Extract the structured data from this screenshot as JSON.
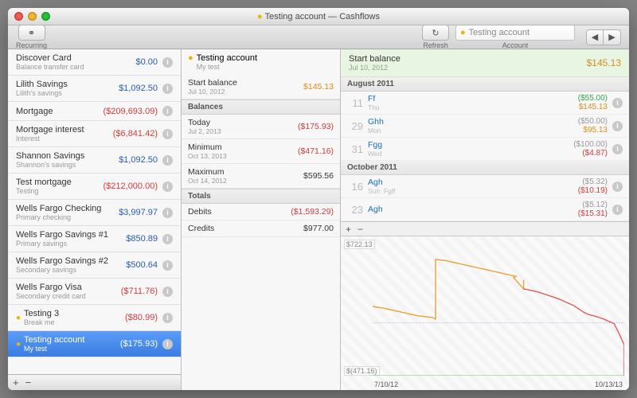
{
  "window": {
    "title": "Testing account — Cashflows"
  },
  "toolbar": {
    "recurring": "Recurring",
    "refresh": "Refresh",
    "account_label": "Account",
    "account_field": "Testing account"
  },
  "accounts": [
    {
      "name": "Discover Card",
      "sub": "Balance transfer card",
      "amount": "$0.00",
      "cls": "blue"
    },
    {
      "name": "Lilith Savings",
      "sub": "Lilith's savings",
      "amount": "$1,092.50",
      "cls": "blue"
    },
    {
      "name": "Mortgage",
      "sub": "",
      "amount": "($209,693.09)",
      "cls": "red"
    },
    {
      "name": "Mortgage interest",
      "sub": "Interest",
      "amount": "($6,841.42)",
      "cls": "red"
    },
    {
      "name": "Shannon Savings",
      "sub": "Shannon's savings",
      "amount": "$1,092.50",
      "cls": "blue"
    },
    {
      "name": "Test mortgage",
      "sub": "Testing",
      "amount": "($212,000.00)",
      "cls": "red"
    },
    {
      "name": "Wells Fargo Checking",
      "sub": "Primary checking",
      "amount": "$3,997.97",
      "cls": "blue"
    },
    {
      "name": "Wells Fargo Savings #1",
      "sub": "Primary savings",
      "amount": "$850.89",
      "cls": "blue"
    },
    {
      "name": "Wells Fargo Savings #2",
      "sub": "Secondary savings",
      "amount": "$500.64",
      "cls": "blue"
    },
    {
      "name": "Wells Fargo Visa",
      "sub": "Secondary credit card",
      "amount": "($711.76)",
      "cls": "red"
    },
    {
      "name": "Testing 3",
      "sub": "Break me",
      "amount": "($80.99)",
      "cls": "red",
      "coin": true
    },
    {
      "name": "Testing account",
      "sub": "My test",
      "amount": "($175.93)",
      "cls": "red",
      "coin": true,
      "selected": true
    }
  ],
  "summary": {
    "title": "Testing account",
    "subtitle": "My test",
    "start": {
      "label": "Start balance",
      "date": "Jul 10, 2012",
      "value": "$145.13",
      "cls": "orange"
    },
    "balances_hdr": "Balances",
    "today": {
      "label": "Today",
      "date": "Jul 2, 2013",
      "value": "($175.93)",
      "cls": "red"
    },
    "minimum": {
      "label": "Minimum",
      "date": "Oct 13, 2013",
      "value": "($471.16)",
      "cls": "red"
    },
    "maximum": {
      "label": "Maximum",
      "date": "Oct 14, 2012",
      "value": "$595.56",
      "cls": "black"
    },
    "totals_hdr": "Totals",
    "debits": {
      "label": "Debits",
      "value": "($1,593.29)",
      "cls": "red"
    },
    "credits": {
      "label": "Credits",
      "value": "$977.00",
      "cls": "black"
    }
  },
  "ledger": {
    "start": {
      "label": "Start balance",
      "date": "Jul 10, 2012",
      "value": "$145.13"
    },
    "months": [
      {
        "label": "August 2011",
        "tx": [
          {
            "day": "11",
            "wd": "Thu",
            "name": "Ff",
            "delta": "($55.00)",
            "bal": "$145.13",
            "dcls": "green",
            "bcls": "orange"
          },
          {
            "day": "29",
            "wd": "Mon",
            "name": "Ghh",
            "delta": "($50.00)",
            "bal": "$95.13",
            "dcls": "gray",
            "bcls": "orange"
          },
          {
            "day": "31",
            "wd": "Wed",
            "name": "Fgg",
            "delta": "($100.00)",
            "bal": "($4.87)",
            "dcls": "gray",
            "bcls": "red"
          }
        ]
      },
      {
        "label": "October 2011",
        "tx": [
          {
            "day": "16",
            "wd": "Sun",
            "sub": "Fgff",
            "name": "Agh",
            "delta": "($5.32)",
            "bal": "($10.19)",
            "dcls": "gray",
            "bcls": "red"
          },
          {
            "day": "23",
            "wd": "",
            "name": "Agh",
            "delta": "($5.12)",
            "bal": "($15.31)",
            "dcls": "gray",
            "bcls": "red"
          }
        ]
      }
    ]
  },
  "chart_data": {
    "type": "line",
    "xlabel_left": "7/10/12",
    "xlabel_right": "10/13/13",
    "ylim": [
      -471.16,
      722.13
    ],
    "ylabel_top": "$722.13",
    "ylabel_bottom": "$(471.16)",
    "series": [
      {
        "name": "orange",
        "color": "#e6a23c",
        "points": [
          [
            0,
            145
          ],
          [
            2,
            135
          ],
          [
            4,
            130
          ],
          [
            6,
            120
          ],
          [
            8,
            110
          ],
          [
            10,
            100
          ],
          [
            12,
            90
          ],
          [
            14,
            80
          ],
          [
            16,
            70
          ],
          [
            18,
            60
          ],
          [
            20,
            55
          ],
          [
            22,
            50
          ],
          [
            24,
            45
          ],
          [
            25,
            30
          ],
          [
            25,
            560
          ],
          [
            27,
            555
          ],
          [
            29,
            550
          ],
          [
            31,
            540
          ],
          [
            33,
            530
          ],
          [
            35,
            520
          ],
          [
            37,
            510
          ],
          [
            39,
            500
          ],
          [
            41,
            490
          ],
          [
            43,
            480
          ],
          [
            45,
            470
          ],
          [
            47,
            460
          ],
          [
            49,
            450
          ],
          [
            51,
            440
          ],
          [
            53,
            430
          ],
          [
            55,
            420
          ],
          [
            57,
            410
          ],
          [
            56,
            400
          ],
          [
            60,
            300
          ],
          [
            60,
            380
          ]
        ]
      },
      {
        "name": "red",
        "color": "#e05b5b",
        "points": [
          [
            60,
            300
          ],
          [
            62,
            290
          ],
          [
            64,
            280
          ],
          [
            66,
            270
          ],
          [
            68,
            255
          ],
          [
            70,
            240
          ],
          [
            72,
            225
          ],
          [
            74,
            210
          ],
          [
            76,
            190
          ],
          [
            78,
            170
          ],
          [
            80,
            150
          ],
          [
            82,
            120
          ],
          [
            84,
            90
          ],
          [
            86,
            70
          ],
          [
            88,
            60
          ],
          [
            90,
            45
          ],
          [
            92,
            30
          ],
          [
            94,
            10
          ],
          [
            96,
            -10
          ],
          [
            98,
            -100
          ],
          [
            100,
            -200
          ],
          [
            100,
            -400
          ],
          [
            100,
            -471
          ]
        ]
      }
    ],
    "dash": {
      "y": 0,
      "color": "#8faede"
    }
  }
}
